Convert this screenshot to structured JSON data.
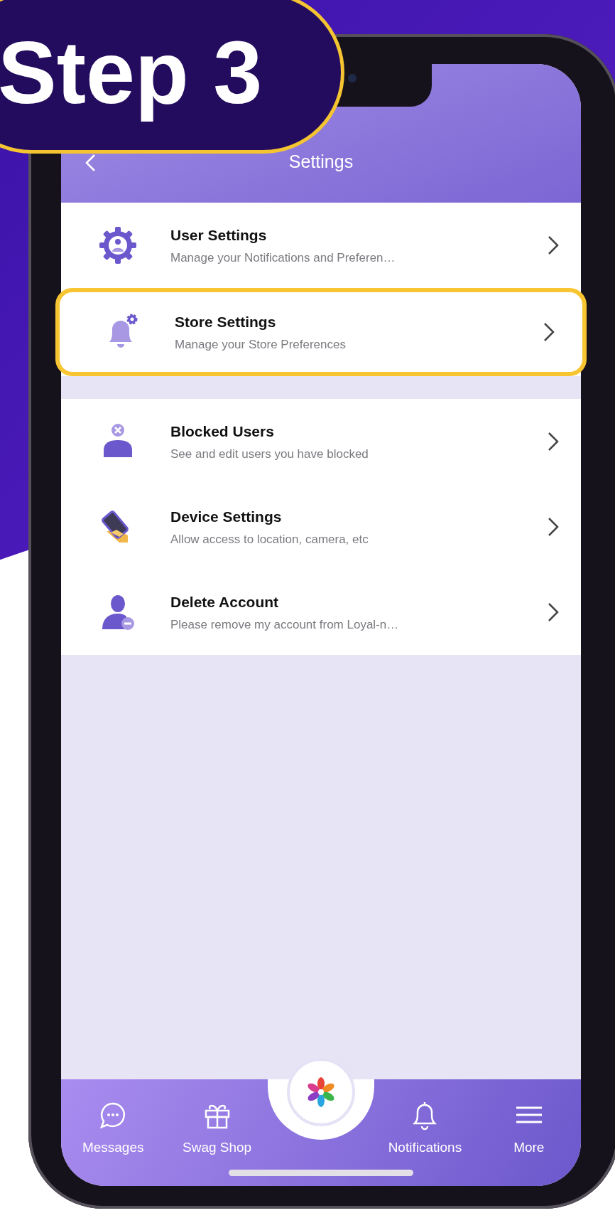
{
  "badge": {
    "text": "Step 3"
  },
  "header": {
    "title": "Settings"
  },
  "groups": [
    [
      {
        "title": "User Settings",
        "subtitle": "Manage your Notifications and Preferen…",
        "highlighted": false
      },
      {
        "title": "Store Settings",
        "subtitle": "Manage your Store Preferences",
        "highlighted": true
      }
    ],
    [
      {
        "title": "Blocked Users",
        "subtitle": "See and edit users you have blocked",
        "highlighted": false
      },
      {
        "title": "Device Settings",
        "subtitle": "Allow access to location, camera, etc",
        "highlighted": false
      },
      {
        "title": "Delete Account",
        "subtitle": "Please remove my account from Loyal-n…",
        "highlighted": false
      }
    ]
  ],
  "tabs": [
    {
      "label": "Messages"
    },
    {
      "label": "Swag Shop"
    },
    {
      "label": "Notifications"
    },
    {
      "label": "More"
    }
  ]
}
